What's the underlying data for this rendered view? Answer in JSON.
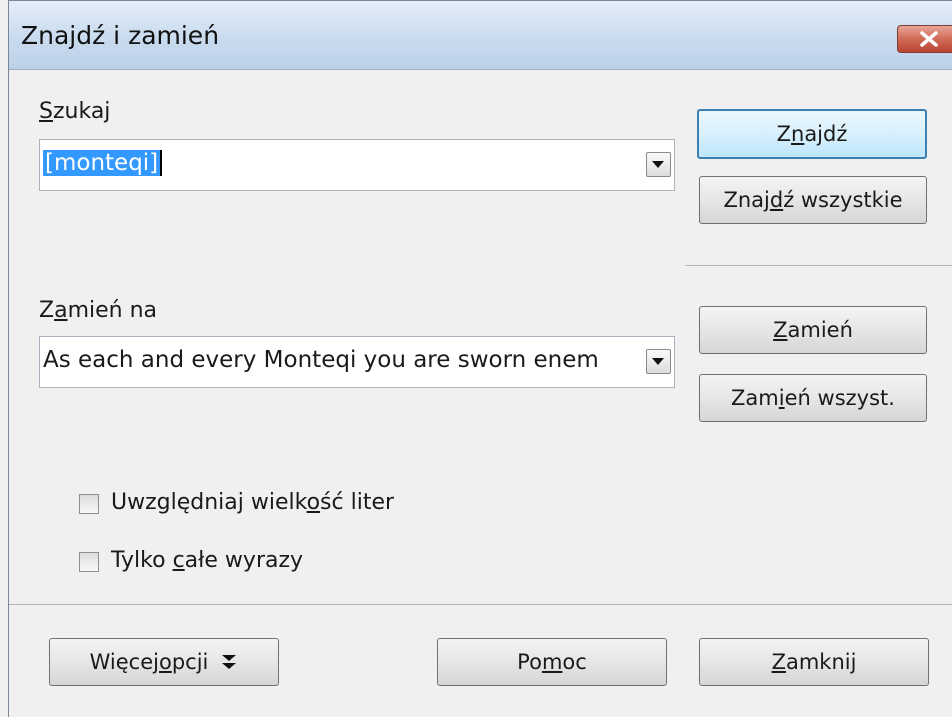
{
  "window": {
    "title": "Znajdź i zamień"
  },
  "search": {
    "label_pre": "",
    "label_u": "S",
    "label_post": "zukaj",
    "value": "[monteqi]"
  },
  "replace": {
    "label_pre": "Z",
    "label_u": "a",
    "label_post": "mień na",
    "value": "As each and every Monteqi you are sworn enem"
  },
  "buttons": {
    "find": {
      "pre": "Z",
      "u": "n",
      "post": "ajdź"
    },
    "find_all": {
      "pre": "Znaj",
      "u": "d",
      "post": "ź wszystkie"
    },
    "replace": {
      "pre": "",
      "u": "Z",
      "post": "amień"
    },
    "replace_all": {
      "pre": "Zam",
      "u": "i",
      "post": "eń wszyst."
    },
    "more_options": {
      "pre": "Więcej ",
      "u": "o",
      "post": "pcji"
    },
    "help": {
      "pre": "Po",
      "u": "m",
      "post": "oc"
    },
    "close": {
      "pre": "",
      "u": "Z",
      "post": "amknij"
    }
  },
  "options": {
    "match_case": {
      "pre": "Uwzględniaj wielk",
      "u": "o",
      "post": "ść liter",
      "checked": false
    },
    "whole_words": {
      "pre": "Tylko ",
      "u": "c",
      "post": "ałe wyrazy",
      "checked": false
    }
  },
  "icons": {
    "close": "close-icon",
    "dropdown": "chevron-down-icon",
    "more": "double-chevron-down-icon"
  }
}
